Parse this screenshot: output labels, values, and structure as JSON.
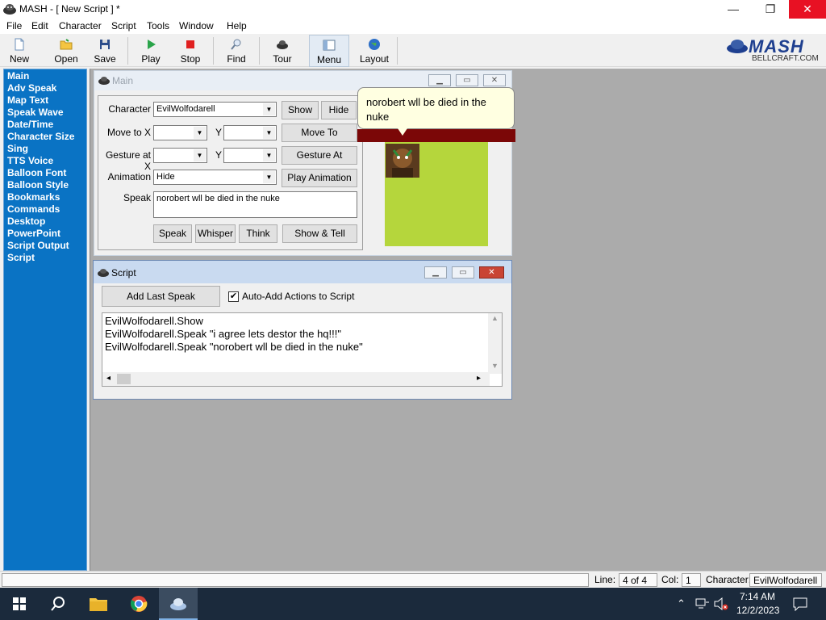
{
  "window": {
    "title": "MASH - [ New Script ] *",
    "controls": {
      "minimize": "—",
      "maximize": "❐",
      "close": "✕"
    }
  },
  "menu": [
    "File",
    "Edit",
    "Character",
    "Script",
    "Tools",
    "Window",
    "Help"
  ],
  "toolbar": [
    "New",
    "Open",
    "Save",
    "Play",
    "Stop",
    "Find",
    "Tour",
    "Menu",
    "Layout"
  ],
  "logo": {
    "brand": "MASH",
    "sub": "BELLCRAFT.COM"
  },
  "nav": [
    "Main",
    "Adv Speak",
    "Map Text",
    "Speak Wave",
    "Date/Time",
    "Character Size",
    "Sing",
    "TTS Voice",
    "Balloon Font",
    "Balloon Style",
    "Bookmarks",
    "Commands",
    "Desktop",
    "PowerPoint",
    "Script Output",
    "Script"
  ],
  "main_window": {
    "title": "Main",
    "character_label": "Character",
    "character_value": "EvilWolfodarell",
    "show": "Show",
    "hide": "Hide",
    "move_to_x_label": "Move to X",
    "y_label": "Y",
    "move_to": "Move To",
    "gesture_at_x_label": "Gesture at X",
    "gesture_at": "Gesture At",
    "animation_label": "Animation",
    "animation_value": "Hide",
    "play_animation": "Play Animation",
    "speak_label": "Speak",
    "speak_text": "norobert wll be died in the nuke",
    "speak": "Speak",
    "whisper": "Whisper",
    "think": "Think",
    "show_tell": "Show & Tell"
  },
  "balloon": {
    "text": "norobert wll be died in the nuke"
  },
  "script_window": {
    "title": "Script",
    "add_last_speak": "Add Last Speak",
    "auto_add_label": "Auto-Add Actions to Script",
    "auto_add_checked": "✔",
    "lines": [
      "EvilWolfodarell.Show",
      "EvilWolfodarell.Speak \"i agree lets destor the hq!!!\"",
      "EvilWolfodarell.Speak \"norobert wll be died in the nuke\""
    ]
  },
  "statusbar": {
    "line_label": "Line:",
    "line_value": "4 of 4",
    "col_label": "Col:",
    "col_value": "1",
    "character_label": "Character:",
    "character_value": "EvilWolfodarell"
  },
  "taskbar": {
    "time": "7:14 AM",
    "date": "12/2/2023"
  }
}
